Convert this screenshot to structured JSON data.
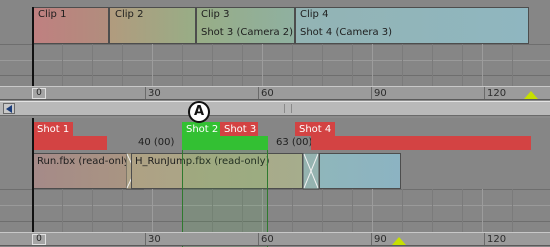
{
  "callout": {
    "label": "A"
  },
  "top_ruler": {
    "start_value": "0",
    "tick_labels": [
      "30",
      "60",
      "90",
      "120"
    ]
  },
  "bottom_ruler": {
    "start_value": "0",
    "tick_labels": [
      "30",
      "60",
      "90",
      "120"
    ]
  },
  "clips": [
    {
      "name": "Clip 1",
      "camera": ""
    },
    {
      "name": "Clip 2",
      "camera": ""
    },
    {
      "name": "Clip 3",
      "camera": "Shot 3 (Camera 2)"
    },
    {
      "name": "Clip 4",
      "camera": "Shot 4 (Camera 3)"
    }
  ],
  "shots": [
    {
      "name": "Shot 1",
      "color": "#d34343"
    },
    {
      "name": "Shot 2",
      "color": "#33c033"
    },
    {
      "name": "Shot 3",
      "color": "#d34343"
    },
    {
      "name": "Shot 4",
      "color": "#d34343"
    }
  ],
  "frame_markers": [
    "40 (00)",
    "63 (00)"
  ],
  "animation_clips": [
    {
      "name": "Run.fbx (read-only)"
    },
    {
      "name": "H_RunJump.fbx (read-only)"
    }
  ],
  "colors": {
    "shot_red": "#d34343",
    "shot_green": "#33c033",
    "marker_green": "#c6e000"
  }
}
